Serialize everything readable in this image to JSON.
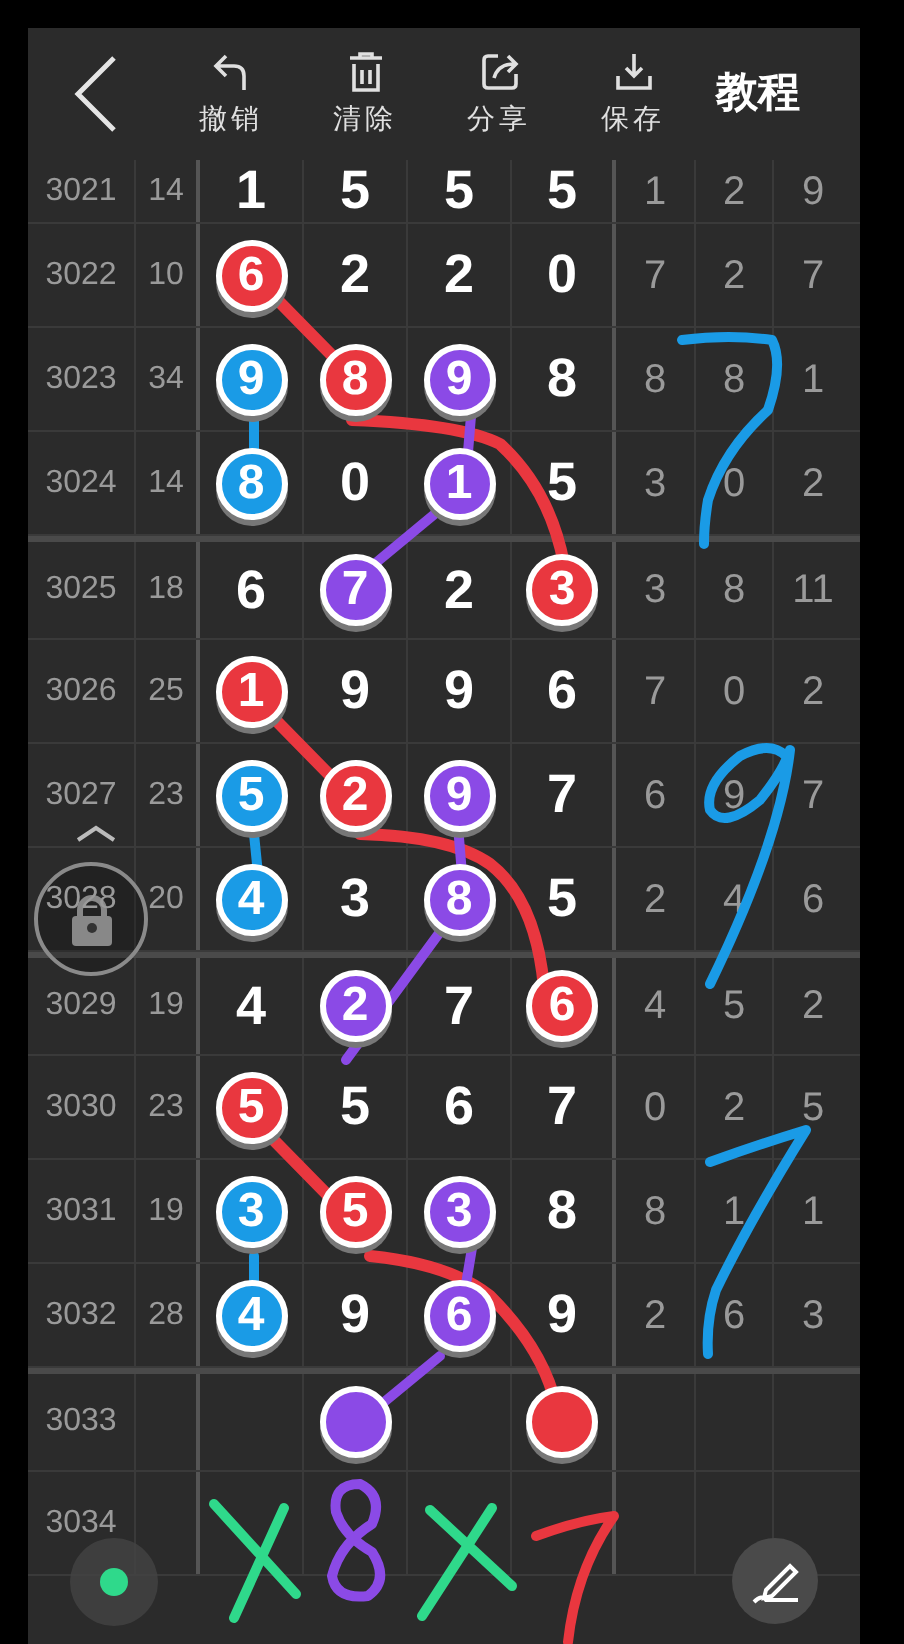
{
  "toolbar": {
    "actions": [
      {
        "label": "撤销"
      },
      {
        "label": "清除"
      },
      {
        "label": "分享"
      },
      {
        "label": "保存"
      }
    ],
    "tutorial": "教程"
  },
  "rows": [
    {
      "period": "3021",
      "sum": "14",
      "digits": [
        {
          "value": "1"
        },
        {
          "value": "5"
        },
        {
          "value": "5"
        },
        {
          "value": "5"
        }
      ],
      "spans": [
        "1",
        "2",
        "9"
      ]
    },
    {
      "period": "3022",
      "sum": "10",
      "digits": [
        {
          "value": "6",
          "color": "#e9373f"
        },
        {
          "value": "2"
        },
        {
          "value": "2"
        },
        {
          "value": "0"
        }
      ],
      "spans": [
        "7",
        "2",
        "7"
      ]
    },
    {
      "period": "3023",
      "sum": "34",
      "digits": [
        {
          "value": "9",
          "color": "#1a9be6"
        },
        {
          "value": "8",
          "color": "#e9373f"
        },
        {
          "value": "9",
          "color": "#8b4ae6"
        },
        {
          "value": "8"
        }
      ],
      "spans": [
        "8",
        "8",
        "1"
      ]
    },
    {
      "period": "3024",
      "sum": "14",
      "digits": [
        {
          "value": "8",
          "color": "#1a9be6"
        },
        {
          "value": "0"
        },
        {
          "value": "1",
          "color": "#8b4ae6"
        },
        {
          "value": "5"
        }
      ],
      "spans": [
        "3",
        "0",
        "2"
      ]
    },
    {
      "period": "3025",
      "sum": "18",
      "digits": [
        {
          "value": "6"
        },
        {
          "value": "7",
          "color": "#8b4ae6"
        },
        {
          "value": "2"
        },
        {
          "value": "3",
          "color": "#e9373f"
        }
      ],
      "spans": [
        "3",
        "8",
        "11"
      ]
    },
    {
      "period": "3026",
      "sum": "25",
      "digits": [
        {
          "value": "1",
          "color": "#e9373f"
        },
        {
          "value": "9"
        },
        {
          "value": "9"
        },
        {
          "value": "6"
        }
      ],
      "spans": [
        "7",
        "0",
        "2"
      ]
    },
    {
      "period": "3027",
      "sum": "23",
      "digits": [
        {
          "value": "5",
          "color": "#1a9be6"
        },
        {
          "value": "2",
          "color": "#e9373f"
        },
        {
          "value": "9",
          "color": "#8b4ae6"
        },
        {
          "value": "7"
        }
      ],
      "spans": [
        "6",
        "9",
        "7"
      ]
    },
    {
      "period": "3028",
      "sum": "20",
      "digits": [
        {
          "value": "4",
          "color": "#1a9be6"
        },
        {
          "value": "3"
        },
        {
          "value": "8",
          "color": "#8b4ae6"
        },
        {
          "value": "5"
        }
      ],
      "spans": [
        "2",
        "4",
        "6"
      ]
    },
    {
      "period": "3029",
      "sum": "19",
      "digits": [
        {
          "value": "4"
        },
        {
          "value": "2",
          "color": "#8b4ae6"
        },
        {
          "value": "7"
        },
        {
          "value": "6",
          "color": "#e9373f"
        }
      ],
      "spans": [
        "4",
        "5",
        "2"
      ]
    },
    {
      "period": "3030",
      "sum": "23",
      "digits": [
        {
          "value": "5",
          "color": "#e9373f"
        },
        {
          "value": "5"
        },
        {
          "value": "6"
        },
        {
          "value": "7"
        }
      ],
      "spans": [
        "0",
        "2",
        "5"
      ]
    },
    {
      "period": "3031",
      "sum": "19",
      "digits": [
        {
          "value": "3",
          "color": "#1a9be6"
        },
        {
          "value": "5",
          "color": "#e9373f"
        },
        {
          "value": "3",
          "color": "#8b4ae6"
        },
        {
          "value": "8"
        }
      ],
      "spans": [
        "8",
        "1",
        "1"
      ]
    },
    {
      "period": "3032",
      "sum": "28",
      "digits": [
        {
          "value": "4",
          "color": "#1a9be6"
        },
        {
          "value": "9"
        },
        {
          "value": "6",
          "color": "#8b4ae6"
        },
        {
          "value": "9"
        }
      ],
      "spans": [
        "2",
        "6",
        "3"
      ]
    },
    {
      "period": "3033",
      "digits": [
        {
          "kind": "empty"
        },
        {
          "kind": "ball",
          "color": "#8b4ae6"
        },
        {
          "kind": "empty"
        },
        {
          "kind": "ball",
          "color": "#e9373f"
        }
      ]
    },
    {
      "period": "3034"
    }
  ]
}
